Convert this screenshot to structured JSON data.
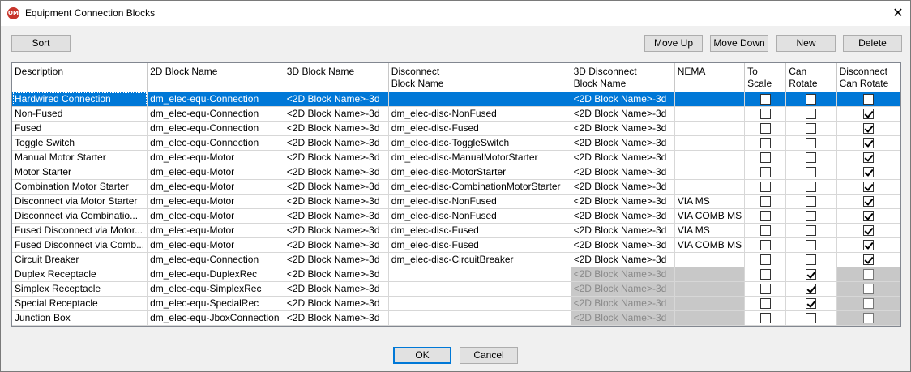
{
  "window": {
    "title": "Equipment Connection Blocks",
    "icon_text": "OM",
    "close_glyph": "✕"
  },
  "toolbar": {
    "sort": "Sort",
    "move_up": "Move Up",
    "move_down": "Move Down",
    "new": "New",
    "delete": "Delete"
  },
  "footer": {
    "ok": "OK",
    "cancel": "Cancel"
  },
  "columns": [
    "Description",
    "2D Block Name",
    "3D Block Name",
    "Disconnect\nBlock Name",
    "3D Disconnect\nBlock Name",
    "NEMA",
    "To Scale",
    "Can Rotate",
    "Disconnect\nCan Rotate"
  ],
  "rows": [
    {
      "desc": "Hardwired Connection",
      "block2d": "dm_elec-equ-Connection",
      "block3d": "<2D Block Name>-3d",
      "disc": "",
      "disc3d": "<2D Block Name>-3d",
      "nema": "",
      "to_scale": false,
      "can_rotate": false,
      "disc_rotate": false,
      "selected": true,
      "disabled_disc": false
    },
    {
      "desc": "Non-Fused",
      "block2d": "dm_elec-equ-Connection",
      "block3d": "<2D Block Name>-3d",
      "disc": "dm_elec-disc-NonFused",
      "disc3d": "<2D Block Name>-3d",
      "nema": "",
      "to_scale": false,
      "can_rotate": false,
      "disc_rotate": true,
      "selected": false,
      "disabled_disc": false
    },
    {
      "desc": "Fused",
      "block2d": "dm_elec-equ-Connection",
      "block3d": "<2D Block Name>-3d",
      "disc": "dm_elec-disc-Fused",
      "disc3d": "<2D Block Name>-3d",
      "nema": "",
      "to_scale": false,
      "can_rotate": false,
      "disc_rotate": true,
      "selected": false,
      "disabled_disc": false
    },
    {
      "desc": "Toggle Switch",
      "block2d": "dm_elec-equ-Connection",
      "block3d": "<2D Block Name>-3d",
      "disc": "dm_elec-disc-ToggleSwitch",
      "disc3d": "<2D Block Name>-3d",
      "nema": "",
      "to_scale": false,
      "can_rotate": false,
      "disc_rotate": true,
      "selected": false,
      "disabled_disc": false
    },
    {
      "desc": "Manual Motor Starter",
      "block2d": "dm_elec-equ-Motor",
      "block3d": "<2D Block Name>-3d",
      "disc": "dm_elec-disc-ManualMotorStarter",
      "disc3d": "<2D Block Name>-3d",
      "nema": "",
      "to_scale": false,
      "can_rotate": false,
      "disc_rotate": true,
      "selected": false,
      "disabled_disc": false
    },
    {
      "desc": "Motor Starter",
      "block2d": "dm_elec-equ-Motor",
      "block3d": "<2D Block Name>-3d",
      "disc": "dm_elec-disc-MotorStarter",
      "disc3d": "<2D Block Name>-3d",
      "nema": "",
      "to_scale": false,
      "can_rotate": false,
      "disc_rotate": true,
      "selected": false,
      "disabled_disc": false
    },
    {
      "desc": "Combination Motor Starter",
      "block2d": "dm_elec-equ-Motor",
      "block3d": "<2D Block Name>-3d",
      "disc": "dm_elec-disc-CombinationMotorStarter",
      "disc3d": "<2D Block Name>-3d",
      "nema": "",
      "to_scale": false,
      "can_rotate": false,
      "disc_rotate": true,
      "selected": false,
      "disabled_disc": false
    },
    {
      "desc": "Disconnect via Motor Starter",
      "block2d": "dm_elec-equ-Motor",
      "block3d": "<2D Block Name>-3d",
      "disc": "dm_elec-disc-NonFused",
      "disc3d": "<2D Block Name>-3d",
      "nema": "VIA MS",
      "to_scale": false,
      "can_rotate": false,
      "disc_rotate": true,
      "selected": false,
      "disabled_disc": false
    },
    {
      "desc": "Disconnect via Combinatio...",
      "block2d": "dm_elec-equ-Motor",
      "block3d": "<2D Block Name>-3d",
      "disc": "dm_elec-disc-NonFused",
      "disc3d": "<2D Block Name>-3d",
      "nema": "VIA COMB MS",
      "to_scale": false,
      "can_rotate": false,
      "disc_rotate": true,
      "selected": false,
      "disabled_disc": false
    },
    {
      "desc": "Fused Disconnect via Motor...",
      "block2d": "dm_elec-equ-Motor",
      "block3d": "<2D Block Name>-3d",
      "disc": "dm_elec-disc-Fused",
      "disc3d": "<2D Block Name>-3d",
      "nema": "VIA MS",
      "to_scale": false,
      "can_rotate": false,
      "disc_rotate": true,
      "selected": false,
      "disabled_disc": false
    },
    {
      "desc": "Fused Disconnect via Comb...",
      "block2d": "dm_elec-equ-Motor",
      "block3d": "<2D Block Name>-3d",
      "disc": "dm_elec-disc-Fused",
      "disc3d": "<2D Block Name>-3d",
      "nema": "VIA COMB MS",
      "to_scale": false,
      "can_rotate": false,
      "disc_rotate": true,
      "selected": false,
      "disabled_disc": false
    },
    {
      "desc": "Circuit Breaker",
      "block2d": "dm_elec-equ-Connection",
      "block3d": "<2D Block Name>-3d",
      "disc": "dm_elec-disc-CircuitBreaker",
      "disc3d": "<2D Block Name>-3d",
      "nema": "",
      "to_scale": false,
      "can_rotate": false,
      "disc_rotate": true,
      "selected": false,
      "disabled_disc": false
    },
    {
      "desc": "Duplex Receptacle",
      "block2d": "dm_elec-equ-DuplexRec",
      "block3d": "<2D Block Name>-3d",
      "disc": "",
      "disc3d": "<2D Block Name>-3d",
      "nema": "",
      "to_scale": false,
      "can_rotate": true,
      "disc_rotate": false,
      "selected": false,
      "disabled_disc": true
    },
    {
      "desc": "Simplex Receptacle",
      "block2d": "dm_elec-equ-SimplexRec",
      "block3d": "<2D Block Name>-3d",
      "disc": "",
      "disc3d": "<2D Block Name>-3d",
      "nema": "",
      "to_scale": false,
      "can_rotate": true,
      "disc_rotate": false,
      "selected": false,
      "disabled_disc": true
    },
    {
      "desc": "Special Receptacle",
      "block2d": "dm_elec-equ-SpecialRec",
      "block3d": "<2D Block Name>-3d",
      "disc": "",
      "disc3d": "<2D Block Name>-3d",
      "nema": "",
      "to_scale": false,
      "can_rotate": true,
      "disc_rotate": false,
      "selected": false,
      "disabled_disc": true
    },
    {
      "desc": "Junction Box",
      "block2d": "dm_elec-equ-JboxConnection",
      "block3d": "<2D Block Name>-3d",
      "disc": "",
      "disc3d": "<2D Block Name>-3d",
      "nema": "",
      "to_scale": false,
      "can_rotate": false,
      "disc_rotate": false,
      "selected": false,
      "disabled_disc": true
    }
  ]
}
